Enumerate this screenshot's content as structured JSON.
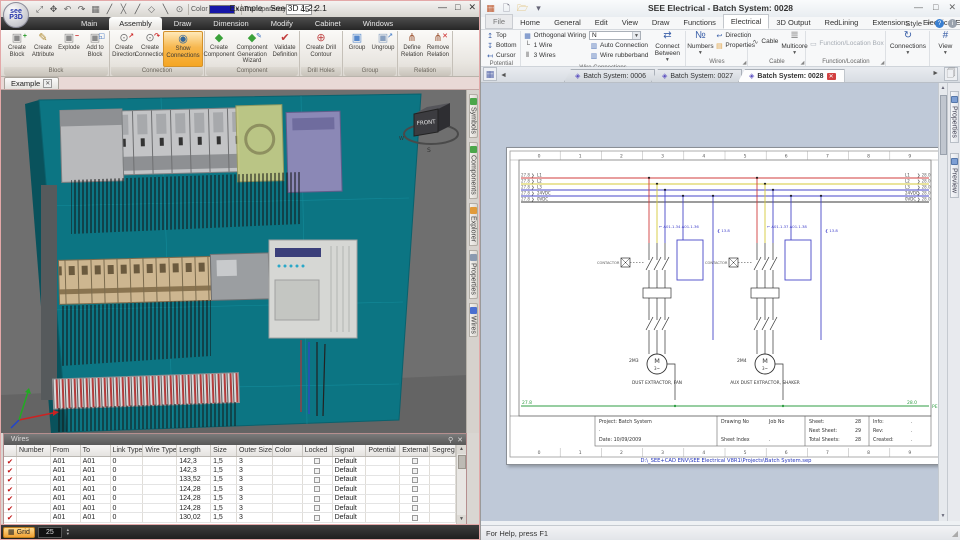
{
  "left_app": {
    "title": "Example - See 3D 1.2.2.1",
    "logo_line1": "see",
    "logo_line2": "P3D",
    "qat_icons": [
      {
        "name": "selection-tools-icon",
        "g": "⤢"
      },
      {
        "name": "pan-icon",
        "g": "✥"
      },
      {
        "name": "undo-icon",
        "g": "↶"
      },
      {
        "name": "redo-icon",
        "g": "↷"
      },
      {
        "name": "grid-snap-icon",
        "g": "▦"
      },
      {
        "name": "line-tool-icon",
        "g": "╱"
      },
      {
        "name": "break-tool-icon",
        "g": "╳"
      },
      {
        "name": "draw-tool-icon",
        "g": "╱"
      },
      {
        "name": "point-snap-icon",
        "g": "◇"
      },
      {
        "name": "measure-icon",
        "g": "╲"
      },
      {
        "name": "compass-icon",
        "g": "⊙"
      }
    ],
    "color_label": "Color",
    "color_value": "#1717a8",
    "transparency_label": "Transparency",
    "transparency_value": "45",
    "window_buttons": {
      "min": "—",
      "max": "□",
      "close": "✕"
    },
    "tabs": [
      "Main",
      "Assembly",
      "Draw",
      "Dimension",
      "Modify",
      "Cabinet",
      "Windows"
    ],
    "active_tab": 1,
    "ribbon_groups": [
      {
        "label": "Block",
        "buttons": [
          {
            "label": "Create\nBlock",
            "icon": {
              "g": "▣",
              "c": "#8a8a8a",
              "b": "+",
              "bc": "#2a9a2a"
            }
          },
          {
            "label": "Create\nAttribute",
            "icon": {
              "g": "✎",
              "c": "#b08a30"
            }
          },
          {
            "label": "Explode",
            "icon": {
              "g": "▣",
              "c": "#8a8a8a",
              "b": "−",
              "bc": "#c22"
            }
          },
          {
            "label": "Add to\nBlock",
            "icon": {
              "g": "▣",
              "c": "#8a8a8a",
              "b": "◱",
              "bc": "#3a6fc0"
            }
          }
        ]
      },
      {
        "label": "Connection",
        "buttons": [
          {
            "label": "Create\nDirection",
            "icon": {
              "g": "⊙",
              "c": "#777",
              "b": "↗",
              "bc": "#c22"
            }
          },
          {
            "label": "Create\nConnection",
            "icon": {
              "g": "⊙",
              "c": "#777",
              "b": "↷",
              "bc": "#c22"
            }
          },
          {
            "label": "Show Connections",
            "icon": {
              "g": "◉",
              "c": "#33669a"
            },
            "highlighted": true,
            "wide": true
          }
        ]
      },
      {
        "label": "Component",
        "buttons": [
          {
            "label": "Create\nComponent",
            "icon": {
              "g": "◆",
              "c": "#3aa13a"
            }
          },
          {
            "label": "Component\nGeneration Wizard",
            "icon": {
              "g": "◆",
              "c": "#3aa13a",
              "b": "✎",
              "bc": "#3a6fc0"
            },
            "wide": true
          },
          {
            "label": "Validate\nDefinition",
            "icon": {
              "g": "✔",
              "c": "#c23a3a"
            }
          }
        ]
      },
      {
        "label": "Drill Holes",
        "buttons": [
          {
            "label": "Create Drill\nContour",
            "icon": {
              "g": "⊕",
              "c": "#c24a4a"
            },
            "wide": true
          }
        ]
      },
      {
        "label": "Group",
        "buttons": [
          {
            "label": "Group",
            "icon": {
              "g": "▣",
              "c": "#5588cc"
            }
          },
          {
            "label": "Ungroup",
            "icon": {
              "g": "▣",
              "c": "#88a0c0",
              "b": "↗",
              "bc": "#5588cc"
            }
          }
        ]
      },
      {
        "label": "Relation",
        "buttons": [
          {
            "label": "Define\nRelation",
            "icon": {
              "g": "⋔",
              "c": "#a05a3a"
            }
          },
          {
            "label": "Remove\nRelation",
            "icon": {
              "g": "⋔",
              "c": "#a05a3a",
              "b": "✕",
              "bc": "#c22"
            }
          }
        ]
      }
    ],
    "viewport_tab": "Example",
    "viewport_tab_close": "✕",
    "viewcube_label": "FRONT",
    "compass": {
      "s": "S",
      "w": "W",
      "e": "E"
    },
    "side_tabs": [
      {
        "label": "Symbols",
        "color": "#4aa64a"
      },
      {
        "label": "Components",
        "color": "#4aa64a"
      },
      {
        "label": "Explorer",
        "color": "#e09a3a"
      },
      {
        "label": "Properties",
        "color": "#8a9ab0"
      },
      {
        "label": "Wires",
        "color": "#4a6fd0"
      }
    ],
    "wires_panel": {
      "title": "Wires",
      "pin_icon": "⚲",
      "close_icon": "✕",
      "columns": [
        "Number",
        "From",
        "To",
        "Link Type",
        "Wire Type",
        "Length",
        "Size",
        "Outer Size",
        "Color",
        "Locked",
        "Signal",
        "Potential",
        "External",
        "Segregatio..."
      ],
      "rows": [
        {
          "from": "A01",
          "to": "A01",
          "link_type": "0",
          "length": "142,3",
          "size": "1,5",
          "outer_size": "3",
          "signal": "Default"
        },
        {
          "from": "A01",
          "to": "A01",
          "link_type": "0",
          "length": "142,3",
          "size": "1,5",
          "outer_size": "3",
          "signal": "Default"
        },
        {
          "from": "A01",
          "to": "A01",
          "link_type": "0",
          "length": "133,52",
          "size": "1,5",
          "outer_size": "3",
          "signal": "Default"
        },
        {
          "from": "A01",
          "to": "A01",
          "link_type": "0",
          "length": "124,28",
          "size": "1,5",
          "outer_size": "3",
          "signal": "Default"
        },
        {
          "from": "A01",
          "to": "A01",
          "link_type": "0",
          "length": "124,28",
          "size": "1,5",
          "outer_size": "3",
          "signal": "Default"
        },
        {
          "from": "A01",
          "to": "A01",
          "link_type": "0",
          "length": "124,28",
          "size": "1,5",
          "outer_size": "3",
          "signal": "Default"
        },
        {
          "from": "A01",
          "to": "A01",
          "link_type": "0",
          "length": "130,02",
          "size": "1,5",
          "outer_size": "3",
          "signal": "Default"
        }
      ],
      "check_glyph": "✔"
    },
    "statusbar": {
      "grid_label": "Grid",
      "grid_icon": "▦",
      "grid_value": "25"
    }
  },
  "right_app": {
    "title": "SEE Electrical - Batch System: 0028",
    "qat_icons": [
      {
        "name": "app-icon",
        "g": "▦",
        "c": "#c05a30"
      },
      {
        "name": "new-document-icon",
        "g": "🗋",
        "c": "#667"
      },
      {
        "name": "open-folder-icon",
        "g": "🗁",
        "c": "#d8a83a"
      },
      {
        "name": "qat-dropdown-icon",
        "g": "▾",
        "c": "#667"
      }
    ],
    "window_buttons": {
      "min": "—",
      "max": "□",
      "close": "✕"
    },
    "tabs": [
      "File",
      "Home",
      "General",
      "Edit",
      "View",
      "Draw",
      "Functions",
      "Electrical",
      "3D Output",
      "RedLining",
      "Extensions",
      "Electrical Ext."
    ],
    "active_tab": 7,
    "style_label": "Style",
    "help_icons": [
      {
        "name": "help-icon",
        "c": "#3a7fd0",
        "g": "?"
      },
      {
        "name": "info-icon",
        "c": "#9aa2ad",
        "g": "i"
      }
    ],
    "ribbon": {
      "potential": {
        "label": "Potential",
        "buttons": [
          "Top",
          "Bottom",
          "Cursor"
        ]
      },
      "wire_connections": {
        "label": "Wire Connections",
        "orthogonal_label": "Orthogonal Wiring",
        "orthogonal_value": "N",
        "wire1": "1 Wire",
        "wire3": "3 Wires",
        "auto": "Auto Connection",
        "rubber": "Wire rubberband",
        "connect_between": "Connect Between"
      },
      "wires": {
        "label": "Wires",
        "numbers": "Numbers",
        "direction": "Direction",
        "properties": "Properties"
      },
      "cable": {
        "label": "Cable",
        "cable": "Cable",
        "multicore": "Multicore"
      },
      "function_location": {
        "label": "Function/Location",
        "box": "Function/Location Box"
      },
      "connections_label": "Connections",
      "view_label": "View"
    },
    "doc_tabs": [
      {
        "label": "Batch System: 0006",
        "active": false
      },
      {
        "label": "Batch System: 0027",
        "active": false
      },
      {
        "label": "Batch System: 0028",
        "active": true
      }
    ],
    "doc_close_icon": "✕",
    "side_tabs": [
      {
        "label": "Properties"
      },
      {
        "label": "Preview"
      }
    ],
    "schematic": {
      "columns": [
        "0",
        "1",
        "2",
        "3",
        "4",
        "5",
        "6",
        "7",
        "8",
        "9"
      ],
      "buses": [
        {
          "name": "L1",
          "color": "#d03c3c",
          "left": "27.8",
          "right": "28.0"
        },
        {
          "name": "L2",
          "color": "#d6ca3a",
          "left": "27.8",
          "right": "28.0"
        },
        {
          "name": "L3",
          "color": "#4747c8",
          "left": "27.8",
          "right": "28.0"
        },
        {
          "name": "24VDC",
          "color": "#4747c8",
          "left": "27.8",
          "right": "28.0"
        },
        {
          "name": "0VDC",
          "color": "#3a3a3a",
          "left": "27.8",
          "right": "28.0"
        }
      ],
      "green_line": {
        "color": "#2f9e43",
        "left": "27.8",
        "right": "28.0",
        "name": "PE"
      },
      "motor_letter": "M",
      "motor_phase": "3~",
      "branches": [
        {
          "tag": "2M3",
          "label": "DUST EXTRACTOR, FAN",
          "refs": "A01.1.34   A01.1.36",
          "ref2": "13.8",
          "contactor": "CONTACTOR"
        },
        {
          "tag": "2M4",
          "label": "AUX DUST EXTRACTOR, SHAKER",
          "refs": "A01.1.37   A01.1.38",
          "ref2": "13.8",
          "contactor": "CONTACTOR"
        }
      ],
      "title_block": {
        "project": "Project: Batch System",
        "dot": ".",
        "date": "Date:   10/09/2009",
        "drawing_no": "Drawing No",
        "job_no": "Job No",
        "sheet_index": "Sheet Index",
        "sheet_index_val": ".",
        "sheet": "Sheet:",
        "sheet_val": "28",
        "next": "Next Sheet:",
        "next_val": "29",
        "total": "Total Sheets:",
        "total_val": "28",
        "info": "Info:",
        "info_val": ".",
        "rev": "Rev:",
        "rev_val": ".",
        "created": "Created:",
        "created_val": "."
      },
      "path": "D:\\_SEE+CAD ENV\\SEE Electrical V8R1\\Projects\\Batch System.sep"
    },
    "statusbar": "For Help, press F1"
  }
}
